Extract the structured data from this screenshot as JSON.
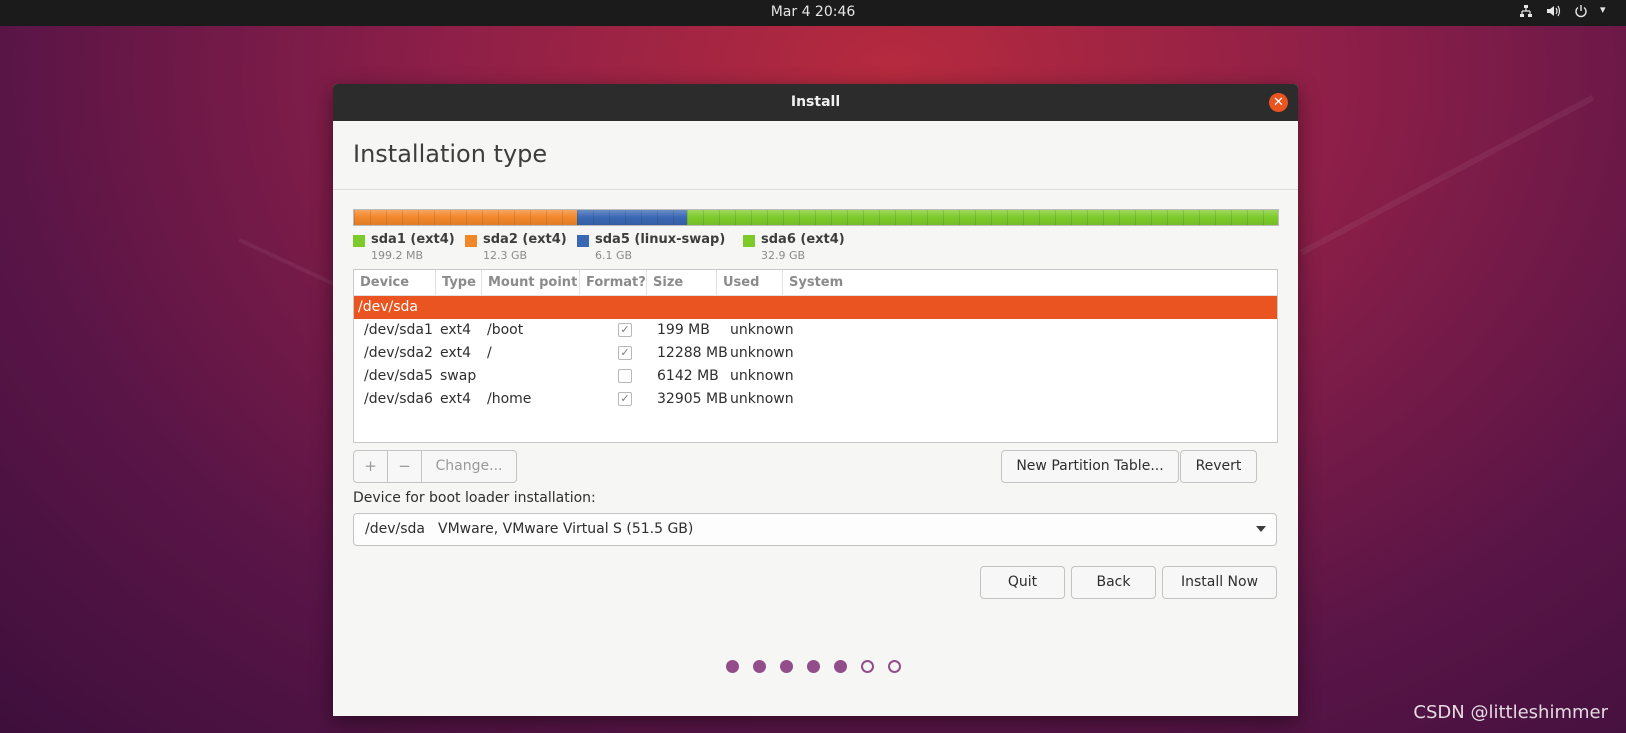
{
  "topbar": {
    "clock": "Mar 4  20:46",
    "tray_icons": [
      "network-icon",
      "volume-icon",
      "power-icon"
    ]
  },
  "window": {
    "title": "Install",
    "heading": "Installation type"
  },
  "partition_bar": {
    "segments": [
      {
        "name": "sda1 (ext4)",
        "color": "#7dcb2b"
      },
      {
        "name": "sda2 (ext4)",
        "color": "#f2872a"
      },
      {
        "name": "sda5 (linux-swap)",
        "color": "#3a67b3"
      },
      {
        "name": "sda6 (ext4)",
        "color": "#7dcb2b"
      }
    ]
  },
  "legend": [
    {
      "name": "sda1 (ext4)",
      "size": "199.2 MB",
      "color": "#7dcb2b"
    },
    {
      "name": "sda2 (ext4)",
      "size": "12.3 GB",
      "color": "#f2872a"
    },
    {
      "name": "sda5 (linux-swap)",
      "size": "6.1 GB",
      "color": "#3a67b3"
    },
    {
      "name": "sda6 (ext4)",
      "size": "32.9 GB",
      "color": "#7dcb2b"
    }
  ],
  "table": {
    "columns": [
      "Device",
      "Type",
      "Mount point",
      "Format?",
      "Size",
      "Used",
      "System"
    ],
    "selected_row": "/dev/sda",
    "rows": [
      {
        "device": "/dev/sda1",
        "type": "ext4",
        "mount": "/boot",
        "format": true,
        "size": "199 MB",
        "used": "unknown",
        "system": ""
      },
      {
        "device": "/dev/sda2",
        "type": "ext4",
        "mount": "/",
        "format": true,
        "size": "12288 MB",
        "used": "unknown",
        "system": ""
      },
      {
        "device": "/dev/sda5",
        "type": "swap",
        "mount": "",
        "format": false,
        "size": "6142 MB",
        "used": "unknown",
        "system": ""
      },
      {
        "device": "/dev/sda6",
        "type": "ext4",
        "mount": "/home",
        "format": true,
        "size": "32905 MB",
        "used": "unknown",
        "system": ""
      }
    ]
  },
  "actions": {
    "add": "+",
    "remove": "−",
    "change": "Change...",
    "new_partition_table": "New Partition Table...",
    "revert": "Revert"
  },
  "boot_loader": {
    "label": "Device for boot loader installation:",
    "device": "/dev/sda",
    "description": "VMware, VMware Virtual S (51.5 GB)"
  },
  "buttons": {
    "quit": "Quit",
    "back": "Back",
    "install_now": "Install Now"
  },
  "progress": {
    "total_steps": 7,
    "completed_steps": 5,
    "accent": "#924d8b"
  },
  "watermark": "CSDN @littleshimmer",
  "colors": {
    "accent": "#e95420",
    "titlebar": "#2c2c2c"
  }
}
